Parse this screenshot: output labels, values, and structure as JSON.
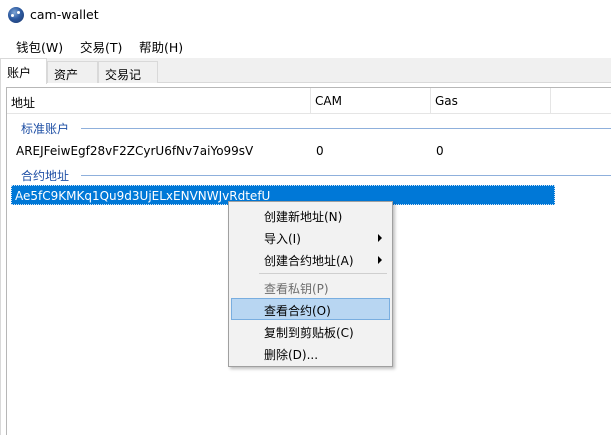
{
  "window": {
    "title": "cam-wallet"
  },
  "menubar": {
    "items": [
      {
        "label": "钱包(W)"
      },
      {
        "label": "交易(T)"
      },
      {
        "label": "帮助(H)"
      }
    ]
  },
  "tabs": [
    {
      "label": "账户",
      "active": true
    },
    {
      "label": "资产",
      "active": false
    },
    {
      "label": "交易记录",
      "active": false
    }
  ],
  "table": {
    "columns": [
      "地址",
      "CAM",
      "Gas"
    ],
    "groups": [
      {
        "label": "标准账户",
        "rows": [
          {
            "address": "AREJFeiwEgf28vF2ZCyrU6fNv7aiYo99sV",
            "cam": "0",
            "gas": "0"
          }
        ]
      },
      {
        "label": "合约地址",
        "rows": [
          {
            "address": "Ae5fC9KMKq1Qu9d3UjELxENVNWJvRdtefU",
            "cam": "",
            "gas": "",
            "selected": true
          }
        ]
      }
    ]
  },
  "context_menu": {
    "items": [
      {
        "label": "创建新地址(N)",
        "submenu": false,
        "disabled": false
      },
      {
        "label": "导入(I)",
        "submenu": true,
        "disabled": false
      },
      {
        "label": "创建合约地址(A)",
        "submenu": true,
        "disabled": false
      },
      {
        "label": "查看私钥(P)",
        "submenu": false,
        "disabled": true
      },
      {
        "label": "查看合约(O)",
        "submenu": false,
        "disabled": false,
        "highlighted": true
      },
      {
        "label": "复制到剪贴板(C)",
        "submenu": false,
        "disabled": false
      },
      {
        "label": "删除(D)...",
        "submenu": false,
        "disabled": false
      }
    ]
  },
  "colors": {
    "selection": "#0078d7",
    "menu_highlight": "#b8d6f2",
    "group_label": "#1e4fa5"
  }
}
